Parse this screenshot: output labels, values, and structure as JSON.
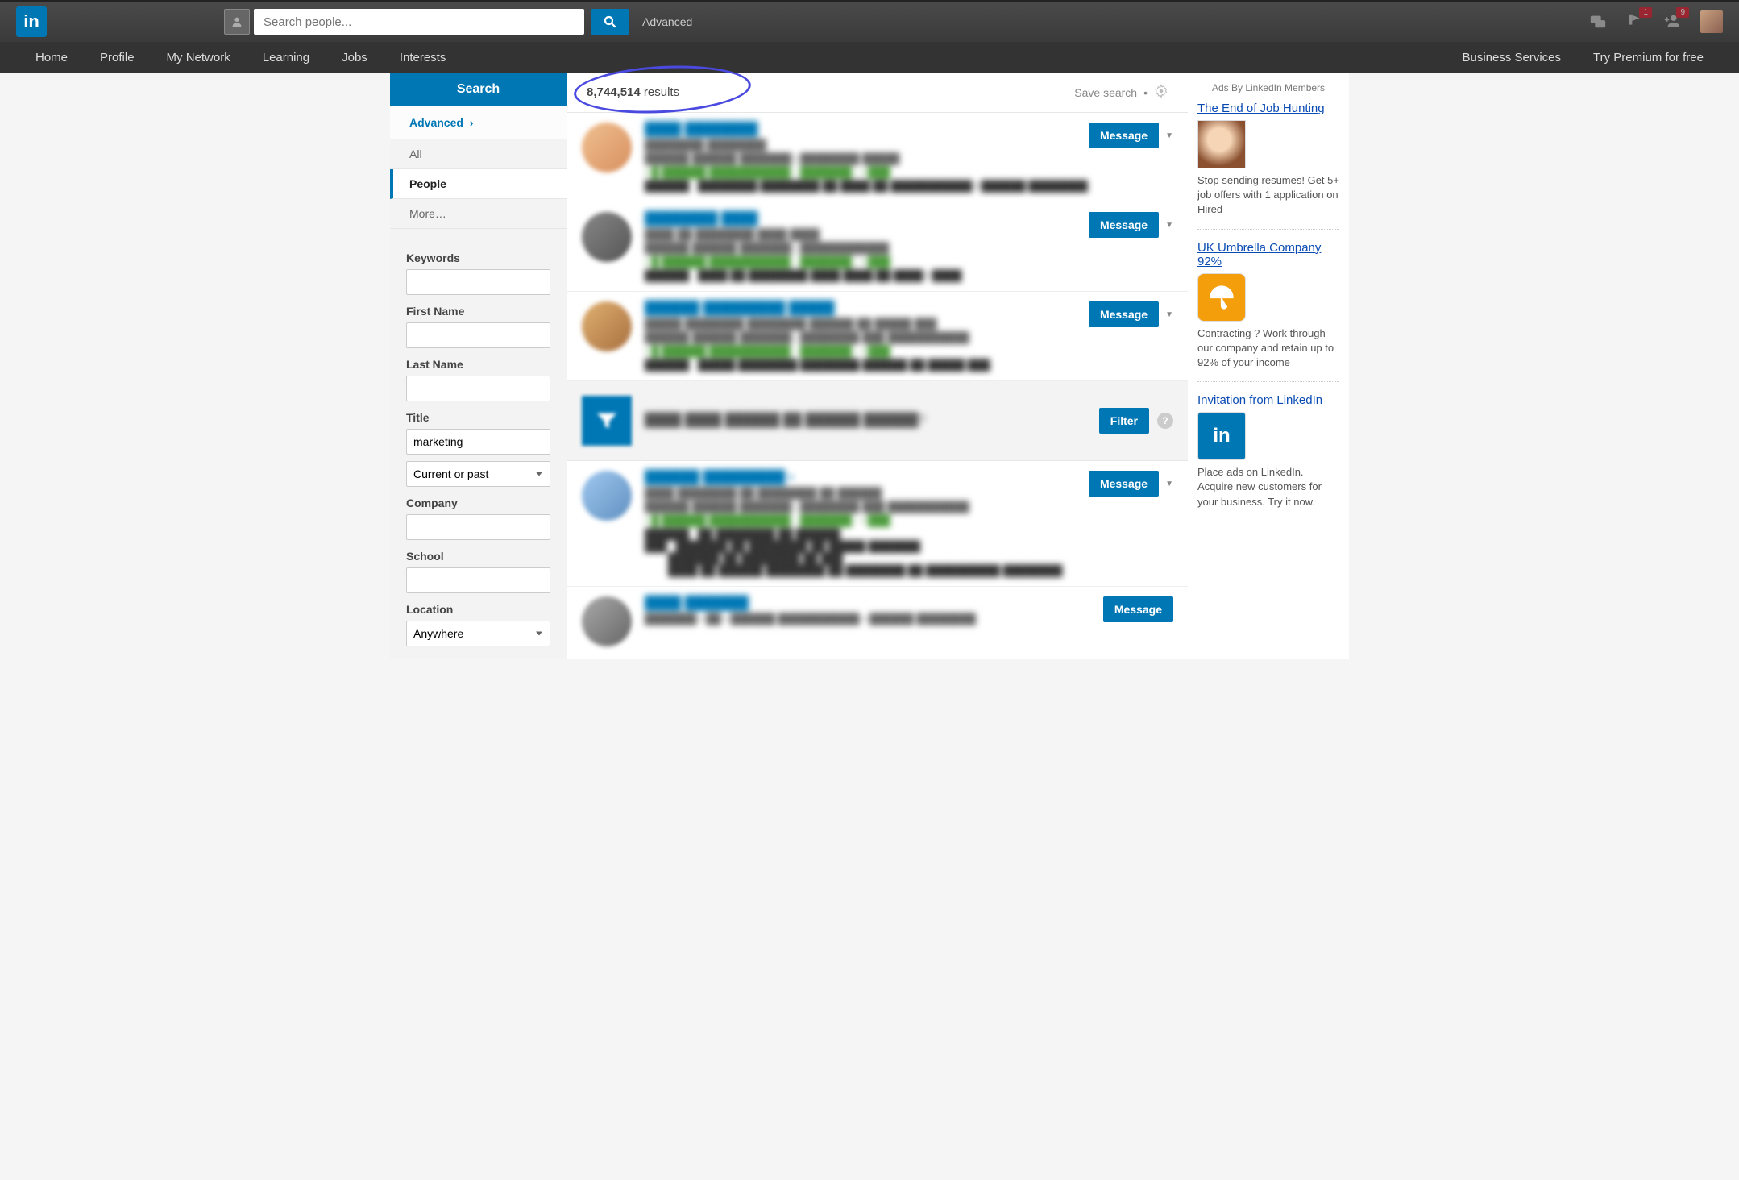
{
  "header": {
    "search_placeholder": "Search people...",
    "advanced_label": "Advanced",
    "badges": {
      "flag": "1",
      "add_person": "9"
    }
  },
  "nav": {
    "home": "Home",
    "profile": "Profile",
    "my_network": "My Network",
    "learning": "Learning",
    "jobs": "Jobs",
    "interests": "Interests",
    "business": "Business Services",
    "premium": "Try Premium for free"
  },
  "sidebar": {
    "search_label": "Search",
    "advanced_label": "Advanced",
    "filter_all": "All",
    "filter_people": "People",
    "filter_more": "More…",
    "labels": {
      "keywords": "Keywords",
      "first_name": "First Name",
      "last_name": "Last Name",
      "title": "Title",
      "title_scope": "Current or past",
      "company": "Company",
      "school": "School",
      "location": "Location",
      "location_value": "Anywhere"
    },
    "values": {
      "keywords": "",
      "first_name": "",
      "last_name": "",
      "title": "marketing",
      "company": "",
      "school": ""
    }
  },
  "results": {
    "count": "8,744,514",
    "count_suffix": " results",
    "save_search": "Save search",
    "message_label": "Message",
    "filter_label": "Filter"
  },
  "rail": {
    "header": "Ads By LinkedIn Members",
    "ads": [
      {
        "title": "The End of Job Hunting",
        "text": "Stop sending resumes! Get 5+ job offers with 1 application on Hired"
      },
      {
        "title": "UK Umbrella Company 92%",
        "text": "Contracting ? Work through our company and retain up to 92% of your income"
      },
      {
        "title": "Invitation from LinkedIn",
        "text": "Place ads on LinkedIn. Acquire new customers for your business. Try it now."
      }
    ]
  }
}
